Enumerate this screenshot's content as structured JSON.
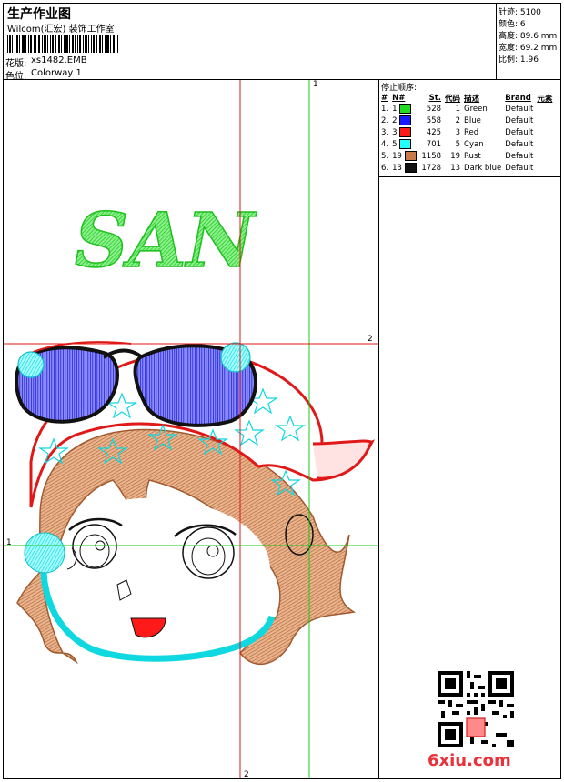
{
  "header": {
    "title": "生产作业图",
    "studio": "Wilcom(汇宏) 装饰工作室",
    "design_label": "花版:",
    "design_value": "xs1482.EMB",
    "colorway_label": "色位:",
    "colorway_value": "Colorway 1"
  },
  "stats": {
    "stitches": "针迹: 5100",
    "colors": "颜色: 6",
    "height": "高度: 89.6 mm",
    "width": "宽度: 69.2 mm",
    "scale": "比例: 1.96"
  },
  "stop_sequence": {
    "title": "停止顺序:",
    "headers": [
      "#",
      "N#",
      "St.",
      "代码",
      "描述",
      "Brand",
      "元素"
    ],
    "rows": [
      {
        "idx": "1.",
        "n": "1",
        "color": "#22dd22",
        "st": "528",
        "code": "1",
        "desc": "Green",
        "brand": "Default"
      },
      {
        "idx": "2.",
        "n": "2",
        "color": "#1a1aff",
        "st": "558",
        "code": "2",
        "desc": "Blue",
        "brand": "Default"
      },
      {
        "idx": "3.",
        "n": "3",
        "color": "#ff1a1a",
        "st": "425",
        "code": "3",
        "desc": "Red",
        "brand": "Default"
      },
      {
        "idx": "4.",
        "n": "5",
        "color": "#22ffff",
        "st": "701",
        "code": "5",
        "desc": "Cyan",
        "brand": "Default"
      },
      {
        "idx": "5.",
        "n": "19",
        "color": "#c87a4a",
        "st": "1158",
        "code": "19",
        "desc": "Rust",
        "brand": "Default"
      },
      {
        "idx": "6.",
        "n": "13",
        "color": "#111111",
        "st": "1728",
        "code": "13",
        "desc": "Dark blue",
        "brand": "Default"
      }
    ]
  },
  "artwork": {
    "text": "SAN",
    "guide_labels": {
      "top": "1",
      "right": "2",
      "left": "1",
      "bottom": "2"
    }
  },
  "watermark": "6xiu.com"
}
